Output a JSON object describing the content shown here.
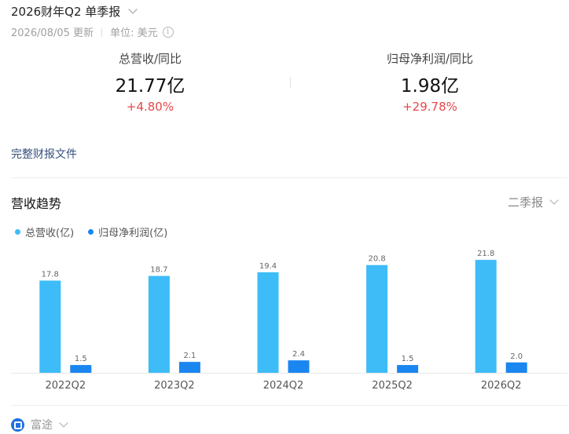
{
  "header": {
    "title": "2026财年Q2 单季报"
  },
  "meta": {
    "date": "2026/08/05 更新",
    "unit": "单位: 美元"
  },
  "metrics": [
    {
      "label": "总营收/同比",
      "value": "21.77亿",
      "change": "+4.80%"
    },
    {
      "label": "归母净利润/同比",
      "value": "1.98亿",
      "change": "+29.78%"
    }
  ],
  "links": {
    "full_report": "完整财报文件"
  },
  "trend": {
    "title": "营收趋势",
    "period": "二季报"
  },
  "footer": {
    "brand": "富途"
  },
  "colors": {
    "revenue": "#3dbcf8",
    "profit": "#1a86f0",
    "up": "#e6464b"
  },
  "chart_data": {
    "type": "bar",
    "categories": [
      "2022Q2",
      "2023Q2",
      "2024Q2",
      "2025Q2",
      "2026Q2"
    ],
    "series": [
      {
        "name": "总营收(亿)",
        "values": [
          17.8,
          18.7,
          19.4,
          20.8,
          21.8
        ],
        "labels": [
          "17.8",
          "18.7",
          "19.4",
          "20.8",
          "21.8"
        ]
      },
      {
        "name": "归母净利润(亿)",
        "values": [
          1.5,
          2.1,
          2.4,
          1.5,
          2.0
        ],
        "labels": [
          "1.5",
          "2.1",
          "2.4",
          "1.5",
          "2.0"
        ]
      }
    ],
    "legend": "top-left",
    "grid": false
  }
}
